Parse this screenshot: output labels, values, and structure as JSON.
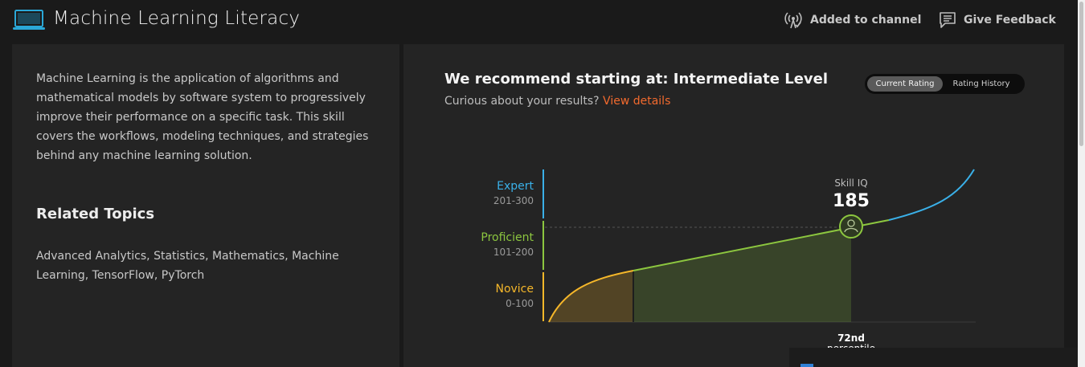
{
  "header": {
    "title": "Machine Learning Literacy",
    "icon": "laptop-icon",
    "added_to_channel": "Added to channel",
    "give_feedback": "Give Feedback"
  },
  "left": {
    "description": "Machine Learning is the application of algorithms and mathematical models by software system to progressively improve their performance on a specific task. This skill covers the workflows, modeling techniques, and strategies behind any machine learning solution.",
    "related_heading": "Related Topics",
    "related_topics": "Advanced Analytics, Statistics, Mathematics, Machine Learning, TensorFlow, PyTorch"
  },
  "right": {
    "recommendation": "We recommend starting at: Intermediate Level",
    "subtitle_prefix": "Curious about your results?",
    "subtitle_link": "View details",
    "toggle": {
      "current": "Current Rating",
      "history": "Rating History"
    }
  },
  "chart_data": {
    "type": "area",
    "levels": [
      {
        "name": "Expert",
        "range": "201-300",
        "min": 201,
        "max": 300,
        "color": "#3ab0e8"
      },
      {
        "name": "Proficient",
        "range": "101-200",
        "min": 101,
        "max": 200,
        "color": "#8cc63f"
      },
      {
        "name": "Novice",
        "range": "0-100",
        "min": 0,
        "max": 100,
        "color": "#f5b72a"
      }
    ],
    "skill_iq_label": "Skill IQ",
    "skill_iq": 185,
    "percentile": 72,
    "percentile_label": "72nd",
    "percentile_suffix": "percentile"
  },
  "colors": {
    "accent_link": "#f26a2e",
    "expert": "#3ab0e8",
    "proficient": "#8cc63f",
    "novice": "#f5b72a",
    "panel": "#242424",
    "background": "#1a1a1a"
  }
}
